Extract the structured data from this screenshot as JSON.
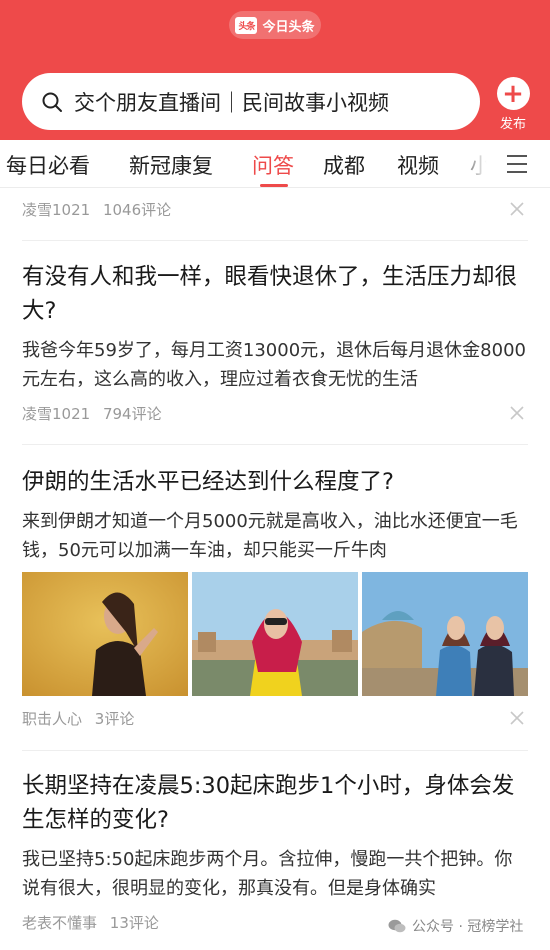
{
  "header": {
    "logo_mark": "头条",
    "app_name": "今日头条",
    "search_text": "交个朋友直播间｜民间故事小视频",
    "publish_label": "发布"
  },
  "tabs": [
    {
      "label": "每日必看"
    },
    {
      "label": "新冠康复"
    },
    {
      "label": "问答",
      "active": true
    },
    {
      "label": "成都"
    },
    {
      "label": "视频"
    },
    {
      "label": "小"
    }
  ],
  "feed": {
    "top_item": {
      "author": "凌雪1021",
      "comments": "1046评论"
    },
    "items": [
      {
        "title": "有没有人和我一样，眼看快退休了，生活压力却很大?",
        "summary": "我爸今年59岁了，每月工资13000元，退休后每月退休金8000元左右，这么高的收入，理应过着衣食无忧的生活",
        "author": "凌雪1021",
        "comments": "794评论"
      },
      {
        "title": "伊朗的生活水平已经达到什么程度了?",
        "summary": "来到伊朗才知道一个月5000元就是高收入，油比水还便宜一毛钱，50元可以加满一车油，却只能买一斤牛肉",
        "author": "职击人心",
        "comments": "3评论"
      },
      {
        "title": "长期坚持在凌晨5:30起床跑步1个小时，身体会发生怎样的变化?",
        "summary": "我已坚持5:50起床跑步两个月。含拉伸，慢跑一共个把钟。你说有很大，很明显的变化，那真没有。但是身体确实",
        "author": "老表不懂事",
        "comments": "13评论"
      }
    ]
  },
  "watermark": "公众号 · 冠榜学社",
  "colors": {
    "brand": "#ee4a4a",
    "meta": "#999999"
  },
  "icons": [
    "search-icon",
    "plus-icon",
    "menu-icon",
    "close-icon",
    "wechat-icon"
  ]
}
